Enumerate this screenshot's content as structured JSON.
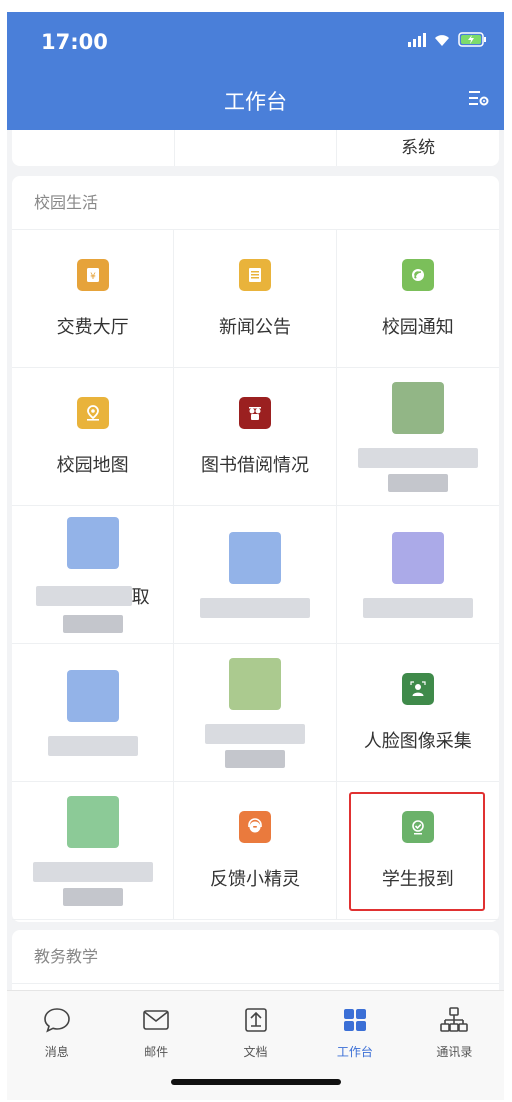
{
  "status_bar": {
    "time": "17:00"
  },
  "header": {
    "title": "工作台"
  },
  "prev_section": {
    "visible_label": "系统"
  },
  "campus": {
    "title": "校园生活",
    "items": [
      {
        "label": "交费大厅",
        "icon": "payment-hall-icon",
        "color": "#e6a33a"
      },
      {
        "label": "新闻公告",
        "icon": "news-icon",
        "color": "#e9b33b"
      },
      {
        "label": "校园通知",
        "icon": "notice-icon",
        "color": "#7bbf5a"
      },
      {
        "label": "校园地图",
        "icon": "map-icon",
        "color": "#e9b33b"
      },
      {
        "label": "图书借阅情况",
        "icon": "library-icon",
        "color": "#9b2020"
      },
      {
        "label": "",
        "icon": "blurred-icon",
        "color": "#6e9d5e"
      },
      {
        "label": "取",
        "icon": "blurred-icon",
        "color": "#6f9ae0"
      },
      {
        "label": "",
        "icon": "blurred-icon",
        "color": "#6f9ae0"
      },
      {
        "label": "",
        "icon": "blurred-icon",
        "color": "#8f8ee0"
      },
      {
        "label": "",
        "icon": "blurred-icon",
        "color": "#6f9ae0"
      },
      {
        "label": "",
        "icon": "blurred-icon",
        "color": "#8fb86a"
      },
      {
        "label": "人脸图像采集",
        "icon": "face-capture-icon",
        "color": "#3f8a4a"
      },
      {
        "label": "",
        "icon": "blurred-icon",
        "color": "#66b874"
      },
      {
        "label": "反馈小精灵",
        "icon": "feedback-icon",
        "color": "#ea7a3d"
      },
      {
        "label": "学生报到",
        "icon": "student-checkin-icon",
        "color": "#6bb26a"
      }
    ]
  },
  "edu": {
    "title": "教务教学"
  },
  "tabbar": {
    "tabs": [
      {
        "label": "消息",
        "icon": "message-icon"
      },
      {
        "label": "邮件",
        "icon": "mail-icon"
      },
      {
        "label": "文档",
        "icon": "document-icon"
      },
      {
        "label": "工作台",
        "icon": "workbench-icon"
      },
      {
        "label": "通讯录",
        "icon": "contacts-icon"
      }
    ],
    "active_color": "#3b6fd6"
  }
}
